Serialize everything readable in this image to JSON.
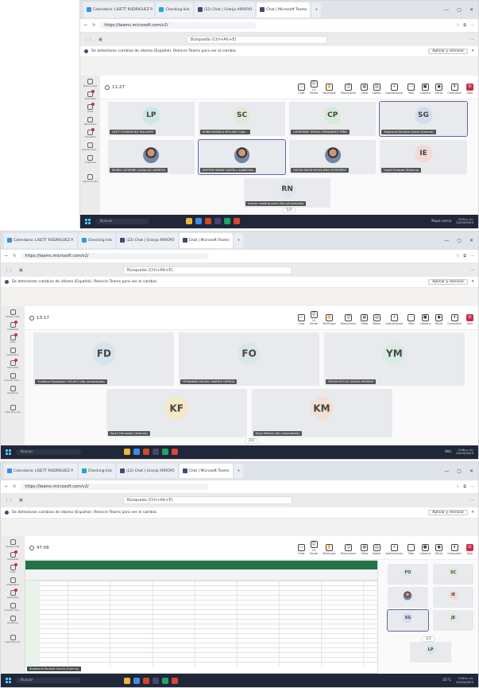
{
  "shots": [
    {
      "browser": {
        "tabs": [
          "Calendario: LISETT RODRIGUEZ P.",
          "Checking link",
          "(22) Chat | Granja ARROYO",
          "Chat | Microsoft Teams",
          "+"
        ],
        "url": "https://teams.microsoft.com/v2/"
      },
      "teams": {
        "search_placeholder": "Búsqueda (Ctrl+Alt+E)",
        "notice": "Se detectaron cambios de idioma (Español). Reinicie Teams para ver el cambio.",
        "notice_button": "Aplicar y reiniciar",
        "rail": [
          "Nuevo chat",
          "Actividad",
          "Chat",
          "Calendario",
          "Llamadas",
          "Arandir Hire...",
          "OneDrive",
          "...",
          "Aplicaciones"
        ],
        "timer": "11:27",
        "controls": [
          {
            "icon": "chat-icon",
            "label": "Chat"
          },
          {
            "icon": "people-icon",
            "label": "Gente",
            "count": "14"
          },
          {
            "icon": "raise-hand-icon",
            "label": "Participar"
          },
          {
            "icon": "react-icon",
            "label": "Reaccionar"
          },
          {
            "icon": "view-icon",
            "label": "Vista"
          },
          {
            "icon": "notes-icon",
            "label": "Notas"
          },
          {
            "icon": "apps-icon",
            "label": "Aplicaciones"
          },
          {
            "icon": "more-icon",
            "label": "Más"
          },
          {
            "icon": "camera-icon",
            "label": "Cámara"
          },
          {
            "icon": "mic-icon",
            "label": "Micro"
          },
          {
            "icon": "share-icon",
            "label": "Compartir"
          },
          {
            "icon": "leave-icon",
            "label": "Salir"
          }
        ],
        "pager": "1/2"
      },
      "tiles": [
        {
          "initials": "LP",
          "name": "LISETT RODRIGUEZ PALLARES",
          "color": "#cfe8e6"
        },
        {
          "initials": "SC",
          "name": "SOBIN DANIELA MOLANO CAJA...",
          "color": "#e0ead7"
        },
        {
          "initials": "CP",
          "name": "CATHERINE TERESA FERNANDEZ PEÑA",
          "color": "#d5ecd9"
        },
        {
          "initials": "SG",
          "name": "Stephania Recalde Garcia (Externo)",
          "color": "#d6dcef",
          "selected": true
        },
        {
          "photo": true,
          "name": "INGRID CATERINE CASALLAS LARROTA",
          "color": "#cfd6e4"
        },
        {
          "photo": true,
          "name": "DIEFFAR HARDE CASTELL SANDOVAL",
          "color": "#cfd6e4",
          "selected": true
        },
        {
          "photo": true,
          "name": "OSCAR DAVID MOSQUERA GUTIERREZ",
          "color": "#cfd6e4"
        },
        {
          "initials": "IE",
          "name": "Ingrid Enriquez (Externo)",
          "color": "#f4d9d5"
        },
        {
          "initials": "RN",
          "name": "marcar meeting notes (No comprobado)",
          "color": "#dbe6ee"
        }
      ],
      "taskbar": {
        "search": "Buscar",
        "weather": "Rayo cerca",
        "time": "3:03 p. m.",
        "date": "24/10/2023"
      }
    },
    {
      "browser": {
        "tabs": [
          "Calendario: LISETT RODRIGUEZ P.",
          "Checking link",
          "(22) Chat | Granja ARROYO",
          "Chat | Microsoft Teams",
          "+"
        ],
        "url": "https://teams.microsoft.com/v2/"
      },
      "teams": {
        "search_placeholder": "Búsqueda (Ctrl+Alt+E)",
        "notice": "Se detectaron cambios de idioma (Español). Reinicie Teams para ver el cambio.",
        "notice_button": "Aplicar y reiniciar",
        "rail": [
          "Nuevo chat",
          "Actividad",
          "Chat",
          "Calendario",
          "Llamadas",
          "Arandir Hire...",
          "OneDrive",
          "...",
          "Aplicaciones"
        ],
        "timer": "13:17",
        "controls": [
          {
            "icon": "chat-icon",
            "label": "Chat"
          },
          {
            "icon": "people-icon",
            "label": "Gente",
            "count": "14"
          },
          {
            "icon": "raise-hand-icon",
            "label": "Participar"
          },
          {
            "icon": "react-icon",
            "label": "Reaccionar"
          },
          {
            "icon": "view-icon",
            "label": "Vista"
          },
          {
            "icon": "notes-icon",
            "label": "Notas"
          },
          {
            "icon": "apps-icon",
            "label": "Aplicaciones"
          },
          {
            "icon": "more-icon",
            "label": "Más"
          },
          {
            "icon": "camera-icon",
            "label": "Cámara"
          },
          {
            "icon": "mic-icon",
            "label": "Micro"
          },
          {
            "icon": "share-icon",
            "label": "Compartir"
          },
          {
            "icon": "leave-icon",
            "label": "Salir"
          }
        ],
        "pager": "2/2"
      },
      "tiles": [
        {
          "initials": "FD",
          "name": "Fredlince Ronhakker OSCAR D (No comprobado)",
          "color": "#d6e4ee"
        },
        {
          "initials": "FO",
          "name": "FERNANDO MIGUEL MARTES ORTEGA",
          "color": "#dbe6e8"
        },
        {
          "initials": "YM",
          "name": "YEISON ESTICE GARCIA MORENO",
          "color": "#d8ece2"
        },
        {
          "initials": "KF",
          "name": "Karen Fernandez (Externo)",
          "color": "#f6e7c7"
        },
        {
          "initials": "KM",
          "name": "Kelys Méndez (No comprobado)",
          "color": "#f3e0d3"
        }
      ],
      "taskbar": {
        "search": "Buscar",
        "weather": "INU",
        "time": "3:06 p. m.",
        "date": "24/10/2023"
      }
    },
    {
      "browser": {
        "tabs": [
          "Calendario: LISETT RODRIGUEZ P.",
          "Checking link",
          "(22) Chat | Granja ARROYO",
          "Chat | Microsoft Teams",
          "+"
        ],
        "url": "https://teams.microsoft.com/v2/"
      },
      "teams": {
        "search_placeholder": "Búsqueda (Ctrl+Alt+E)",
        "notice": "Se detectaron cambios de idioma (Español). Reinicie Teams para ver el cambio.",
        "notice_button": "Aplicar y reiniciar",
        "rail": [
          "Nuevo chat",
          "Actividad",
          "Chat",
          "Calendario",
          "Llamadas",
          "Arandir Hire...",
          "OneDrive",
          "...",
          "Aplicaciones"
        ],
        "timer": "47:06",
        "controls": [
          {
            "icon": "chat-icon",
            "label": "Chat"
          },
          {
            "icon": "people-icon",
            "label": "Gente",
            "count": "15"
          },
          {
            "icon": "raise-hand-icon",
            "label": "Participar"
          },
          {
            "icon": "react-icon",
            "label": "Reaccionar"
          },
          {
            "icon": "view-icon",
            "label": "Vista"
          },
          {
            "icon": "notes-icon",
            "label": "Notas"
          },
          {
            "icon": "apps-icon",
            "label": "Aplicaciones"
          },
          {
            "icon": "more-icon",
            "label": "Más"
          },
          {
            "icon": "camera-icon",
            "label": "Cámara"
          },
          {
            "icon": "mic-icon",
            "label": "Micro"
          },
          {
            "icon": "share-icon",
            "label": "Compartir"
          },
          {
            "icon": "leave-icon",
            "label": "Salir"
          }
        ],
        "pager": "1/2",
        "share_tag": "Stephania Recalde Garcia (Externo)"
      },
      "tiles": [
        {
          "initials": "FO",
          "color": "#dbe6e8"
        },
        {
          "initials": "SC",
          "color": "#e0ead7"
        },
        {
          "photo": true,
          "color": "#cfd6e4"
        },
        {
          "initials": "IE",
          "color": "#f4d9d5"
        },
        {
          "initials": "SG",
          "color": "#d6dcef",
          "selected": true
        },
        {
          "initials": "JE",
          "color": "#e3ead9"
        },
        {
          "initials": "LP",
          "color": "#cfe8e6"
        }
      ],
      "taskbar": {
        "search": "Buscar",
        "weather": "31°C",
        "time": "3:40 p. m.",
        "date": "24/10/2023"
      }
    }
  ]
}
